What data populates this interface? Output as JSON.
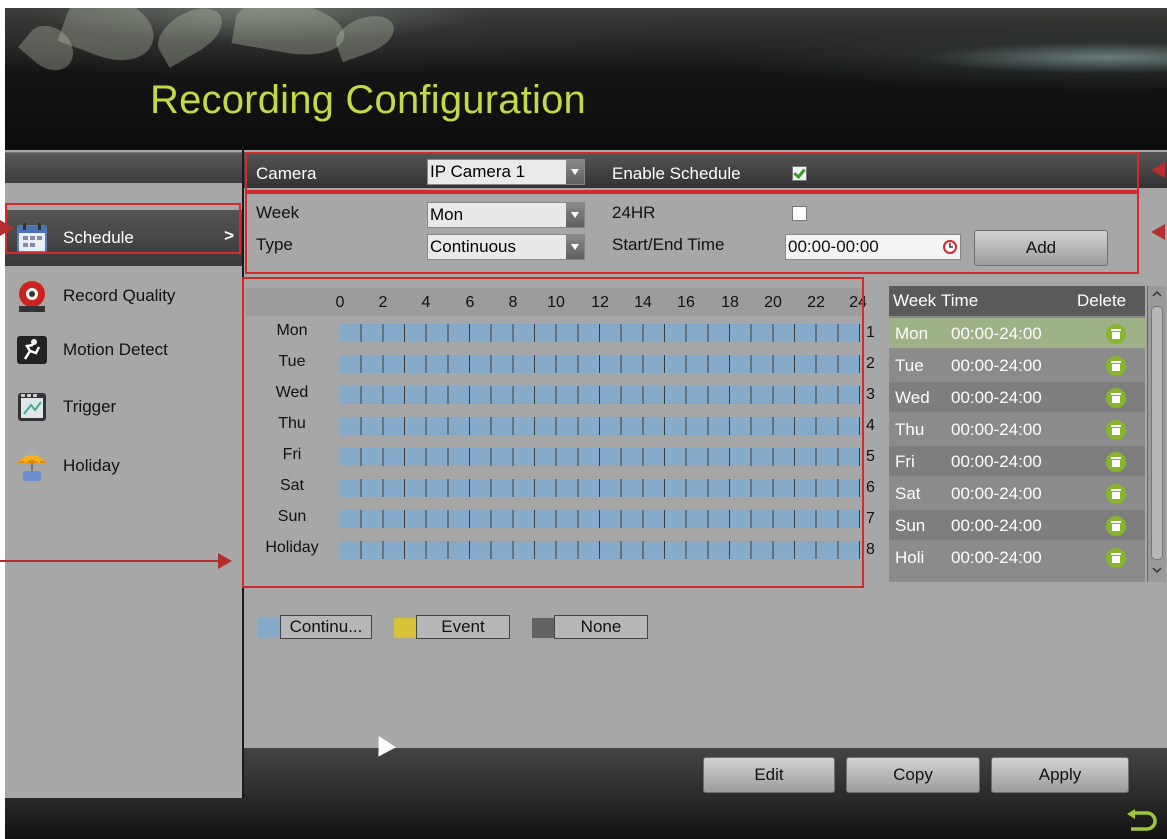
{
  "window": {
    "title": "Recording Configuration"
  },
  "sidebar": {
    "items": [
      {
        "label": "Schedule",
        "icon": "calendar-icon",
        "active": true,
        "chevron": ">"
      },
      {
        "label": "Record Quality",
        "icon": "record-icon"
      },
      {
        "label": "Motion Detect",
        "icon": "motion-icon"
      },
      {
        "label": "Trigger",
        "icon": "trigger-icon"
      },
      {
        "label": "Holiday",
        "icon": "holiday-icon"
      }
    ]
  },
  "camera_row": {
    "camera_label": "Camera",
    "camera_value": "IP Camera 1",
    "enable_label": "Enable Schedule",
    "enable_checked": true
  },
  "settings": {
    "week_label": "Week",
    "week_value": "Mon",
    "hr24_label": "24HR",
    "hr24_checked": false,
    "type_label": "Type",
    "type_value": "Continuous",
    "time_label": "Start/End Time",
    "time_value": "00:00-00:00",
    "add_label": "Add"
  },
  "grid": {
    "hours": [
      "0",
      "2",
      "4",
      "6",
      "8",
      "10",
      "12",
      "14",
      "16",
      "18",
      "20",
      "22",
      "24"
    ],
    "days": [
      {
        "label": "Mon",
        "num": "1"
      },
      {
        "label": "Tue",
        "num": "2"
      },
      {
        "label": "Wed",
        "num": "3"
      },
      {
        "label": "Thu",
        "num": "4"
      },
      {
        "label": "Fri",
        "num": "5"
      },
      {
        "label": "Sat",
        "num": "6"
      },
      {
        "label": "Sun",
        "num": "7"
      },
      {
        "label": "Holiday",
        "num": "8"
      }
    ]
  },
  "list": {
    "headers": {
      "week": "Week",
      "time": "Time",
      "delete": "Delete"
    },
    "rows": [
      {
        "week": "Mon",
        "time": "00:00-24:00"
      },
      {
        "week": "Tue",
        "time": "00:00-24:00"
      },
      {
        "week": "Wed",
        "time": "00:00-24:00"
      },
      {
        "week": "Thu",
        "time": "00:00-24:00"
      },
      {
        "week": "Fri",
        "time": "00:00-24:00"
      },
      {
        "week": "Sat",
        "time": "00:00-24:00"
      },
      {
        "week": "Sun",
        "time": "00:00-24:00"
      },
      {
        "week": "Holi",
        "time": "00:00-24:00"
      }
    ]
  },
  "legend": {
    "continuous": "Continu...",
    "event": "Event",
    "none": "None",
    "colors": {
      "continuous": "#86aac9",
      "event": "#d9c23c",
      "none": "#636363"
    }
  },
  "actions": {
    "edit": "Edit",
    "copy": "Copy",
    "apply": "Apply"
  },
  "colors": {
    "title": "#c5d845",
    "annotation": "#d42a2a",
    "selected_row": "#9eb187"
  }
}
